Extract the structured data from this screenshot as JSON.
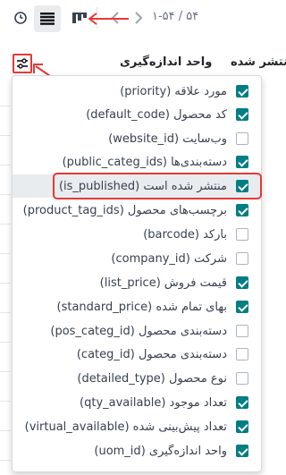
{
  "toolbar": {
    "pager": "۱-۵۴ / ۵۴",
    "icons": [
      "clock-icon",
      "list-view-icon",
      "kanban-view-icon",
      "chevron-left-icon",
      "chevron-right-icon"
    ]
  },
  "header": {
    "col_uom": "واحد اندازه‌گیری",
    "col_published": "منتشر شده"
  },
  "colors": {
    "accent": "#017e84",
    "annotation": "#e53935"
  },
  "columns": [
    {
      "label": "مورد علاقه (priority)",
      "checked": true
    },
    {
      "label": "کد محصول (default_code)",
      "checked": true
    },
    {
      "label": "وب‌سایت (website_id)",
      "checked": false
    },
    {
      "label": "دسته‌بندی‌ها (public_categ_ids)",
      "checked": true
    },
    {
      "label": "منتشر شده است (is_published)",
      "checked": true,
      "highlighted": true
    },
    {
      "label": "برچسب‌های محصول (product_tag_ids)",
      "checked": true
    },
    {
      "label": "بارکد (barcode)",
      "checked": false
    },
    {
      "label": "شرکت (company_id)",
      "checked": false
    },
    {
      "label": "قیمت فروش (list_price)",
      "checked": true
    },
    {
      "label": "بهای تمام شده (standard_price)",
      "checked": true
    },
    {
      "label": "دسته‌بندی محصول (pos_categ_id)",
      "checked": false
    },
    {
      "label": "دسته‌بندی محصول (categ_id)",
      "checked": false
    },
    {
      "label": "نوع محصول (detailed_type)",
      "checked": false
    },
    {
      "label": "تعداد موجود (qty_available)",
      "checked": true
    },
    {
      "label": "تعداد پیش‌بینی شده (virtual_available)",
      "checked": true
    },
    {
      "label": "واحد اندازه‌گیری (uom_id)",
      "checked": true
    }
  ]
}
